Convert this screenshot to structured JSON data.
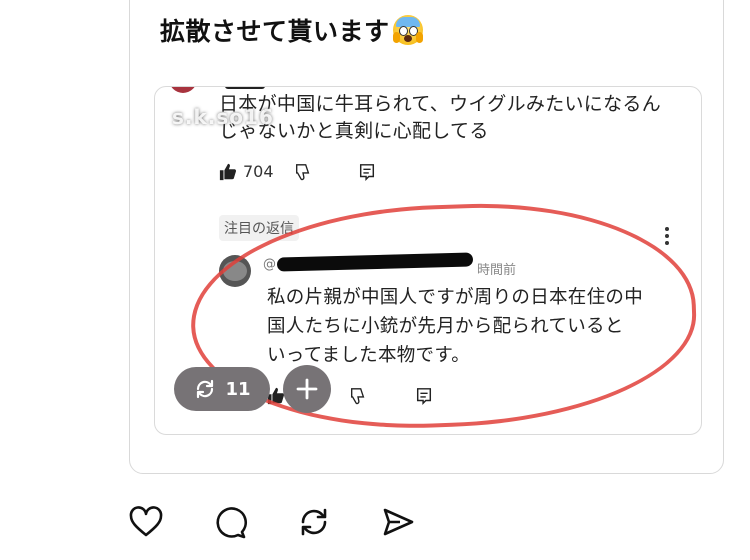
{
  "post": {
    "text": "拡散させて貰います",
    "emoji_icon": "face-screaming-in-fear"
  },
  "quote_image": {
    "watermark": "s.k.so16",
    "comment1": {
      "line1": "日本が中国に牛耳られて、ウイグルみたいになるん",
      "line2": "じゃないかと真剣に心配してる",
      "likes": "704"
    },
    "highlight_tag": "注目の返信",
    "reply": {
      "handle_prefix": "@",
      "time_fragment": "時間前",
      "line1": "私の片親が中国人ですが周りの日本在住の中",
      "line2": "国人たちに小銃が先月から配られていると",
      "line3": "いってました本物です。"
    },
    "annotation_color": "#e0403a"
  },
  "overlay": {
    "repost_count": "11",
    "repost_icon": "repost-icon",
    "add_icon": "plus-icon",
    "pill_color": "#777376"
  },
  "bottom_actions": {
    "icons": [
      "heart-icon",
      "comment-icon",
      "repost-icon",
      "share-icon"
    ]
  }
}
